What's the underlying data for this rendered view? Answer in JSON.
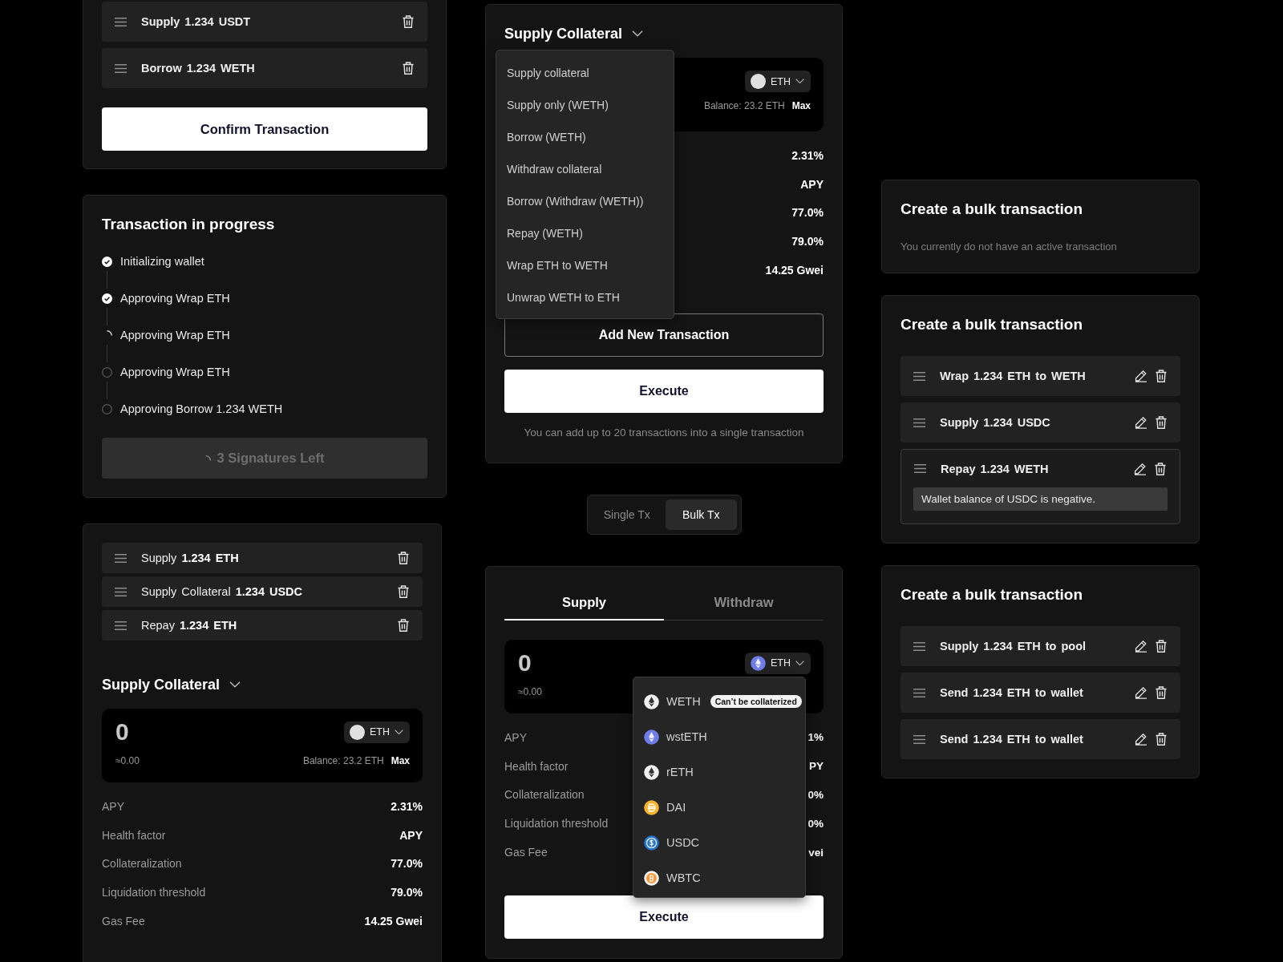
{
  "queue_card": {
    "items": [
      {
        "text": "Supply 1.234 USDT"
      },
      {
        "text": "Borrow 1.234 WETH"
      }
    ],
    "confirm_button": "Confirm Transaction"
  },
  "progress_card": {
    "title": "Transaction in progress",
    "steps": [
      {
        "label": "Initializing wallet",
        "kind": "done"
      },
      {
        "label": "Approving Wrap ETH",
        "kind": "done"
      },
      {
        "label": "Approving Wrap ETH",
        "kind": "active"
      },
      {
        "label": "Approving Wrap ETH",
        "kind": "pending"
      },
      {
        "label": "Approving Borrow 1.234 WETH",
        "kind": "pending"
      }
    ],
    "button": {
      "label": "3 Signatures Left",
      "disabled": true
    }
  },
  "collateral_card": {
    "items": [
      {
        "text": "Supply **1.234 ETH**"
      },
      {
        "text": "Supply Collateral **1.234 USDC**"
      },
      {
        "text": "Repay **1.234 ETH**"
      }
    ],
    "form_title": "Supply Collateral",
    "amount": "0",
    "fiat": "≈0.00",
    "token": "ETH",
    "balance": "Balance: 23.2 ETH",
    "max": "Max",
    "stats": [
      {
        "label": "APY",
        "value": "2.31%"
      },
      {
        "label": "Health factor",
        "value": "APY"
      },
      {
        "label": "Collateralization",
        "value": "77.0%"
      },
      {
        "label": "Liquidation threshold",
        "value": "79.0%"
      },
      {
        "label": "Gas Fee",
        "value": "14.25 Gwei"
      }
    ]
  },
  "action_card": {
    "form_title": "Supply Collateral",
    "token": "ETH",
    "balance": "Balance: 23.2 ETH",
    "max": "Max",
    "menu": [
      "Supply collateral",
      "Supply only (WETH)",
      "Borrow (WETH)",
      "Withdraw collateral",
      "Borrow (Withdraw (WETH))",
      "Repay (WETH)",
      "Wrap ETH to WETH",
      "Unwrap WETH to ETH"
    ],
    "stat_values": [
      "2.31%",
      "APY",
      "77.0%",
      "79.0%",
      "14.25 Gwei"
    ],
    "add_button": "Add New Transaction",
    "execute_button": "Execute",
    "note": "You can add up to 20 transactions into a single transaction"
  },
  "mode_toggle": {
    "options": [
      {
        "label": "Single Tx",
        "selected": false
      },
      {
        "label": "Bulk Tx",
        "selected": true
      }
    ]
  },
  "supply_card": {
    "tabs": [
      {
        "label": "Supply",
        "selected": true
      },
      {
        "label": "Withdraw",
        "selected": false
      }
    ],
    "amount": "0",
    "fiat": "≈0.00",
    "token": "ETH",
    "stats": [
      {
        "label": "APY",
        "value": "1%"
      },
      {
        "label": "Health factor",
        "value": "PY"
      },
      {
        "label": "Collateralization",
        "value": "0%"
      },
      {
        "label": "Liquidation threshold",
        "value": "0%"
      },
      {
        "label": "Gas Fee",
        "value": "vei"
      }
    ],
    "assets": [
      {
        "name": "WETH",
        "kind": "eth",
        "tag": "Can’t be collaterized"
      },
      {
        "name": "wstETH",
        "kind": "steth"
      },
      {
        "name": "rETH",
        "kind": "eth"
      },
      {
        "name": "DAI",
        "kind": "dai"
      },
      {
        "name": "USDC",
        "kind": "usdc"
      },
      {
        "name": "WBTC",
        "kind": "btc"
      }
    ],
    "execute_button": "Execute"
  },
  "bulk_cards": [
    {
      "title": "Create a bulk transaction",
      "note": "You currently do not have an active transaction"
    },
    {
      "title": "Create a bulk transaction",
      "items": [
        {
          "text": "Wrap 1.234 ETH to WETH"
        },
        {
          "text": "Supply 1.234 USDC"
        },
        {
          "text": "Repay 1.234 WETH",
          "error": "Wallet balance of USDC is negative."
        }
      ]
    },
    {
      "title": "Create a bulk transaction",
      "items": [
        {
          "text": "Supply 1.234 ETH to pool"
        },
        {
          "text": "Send 1.234 ETH to wallet"
        },
        {
          "text": "Send 1.234 ETH to wallet"
        }
      ]
    }
  ]
}
